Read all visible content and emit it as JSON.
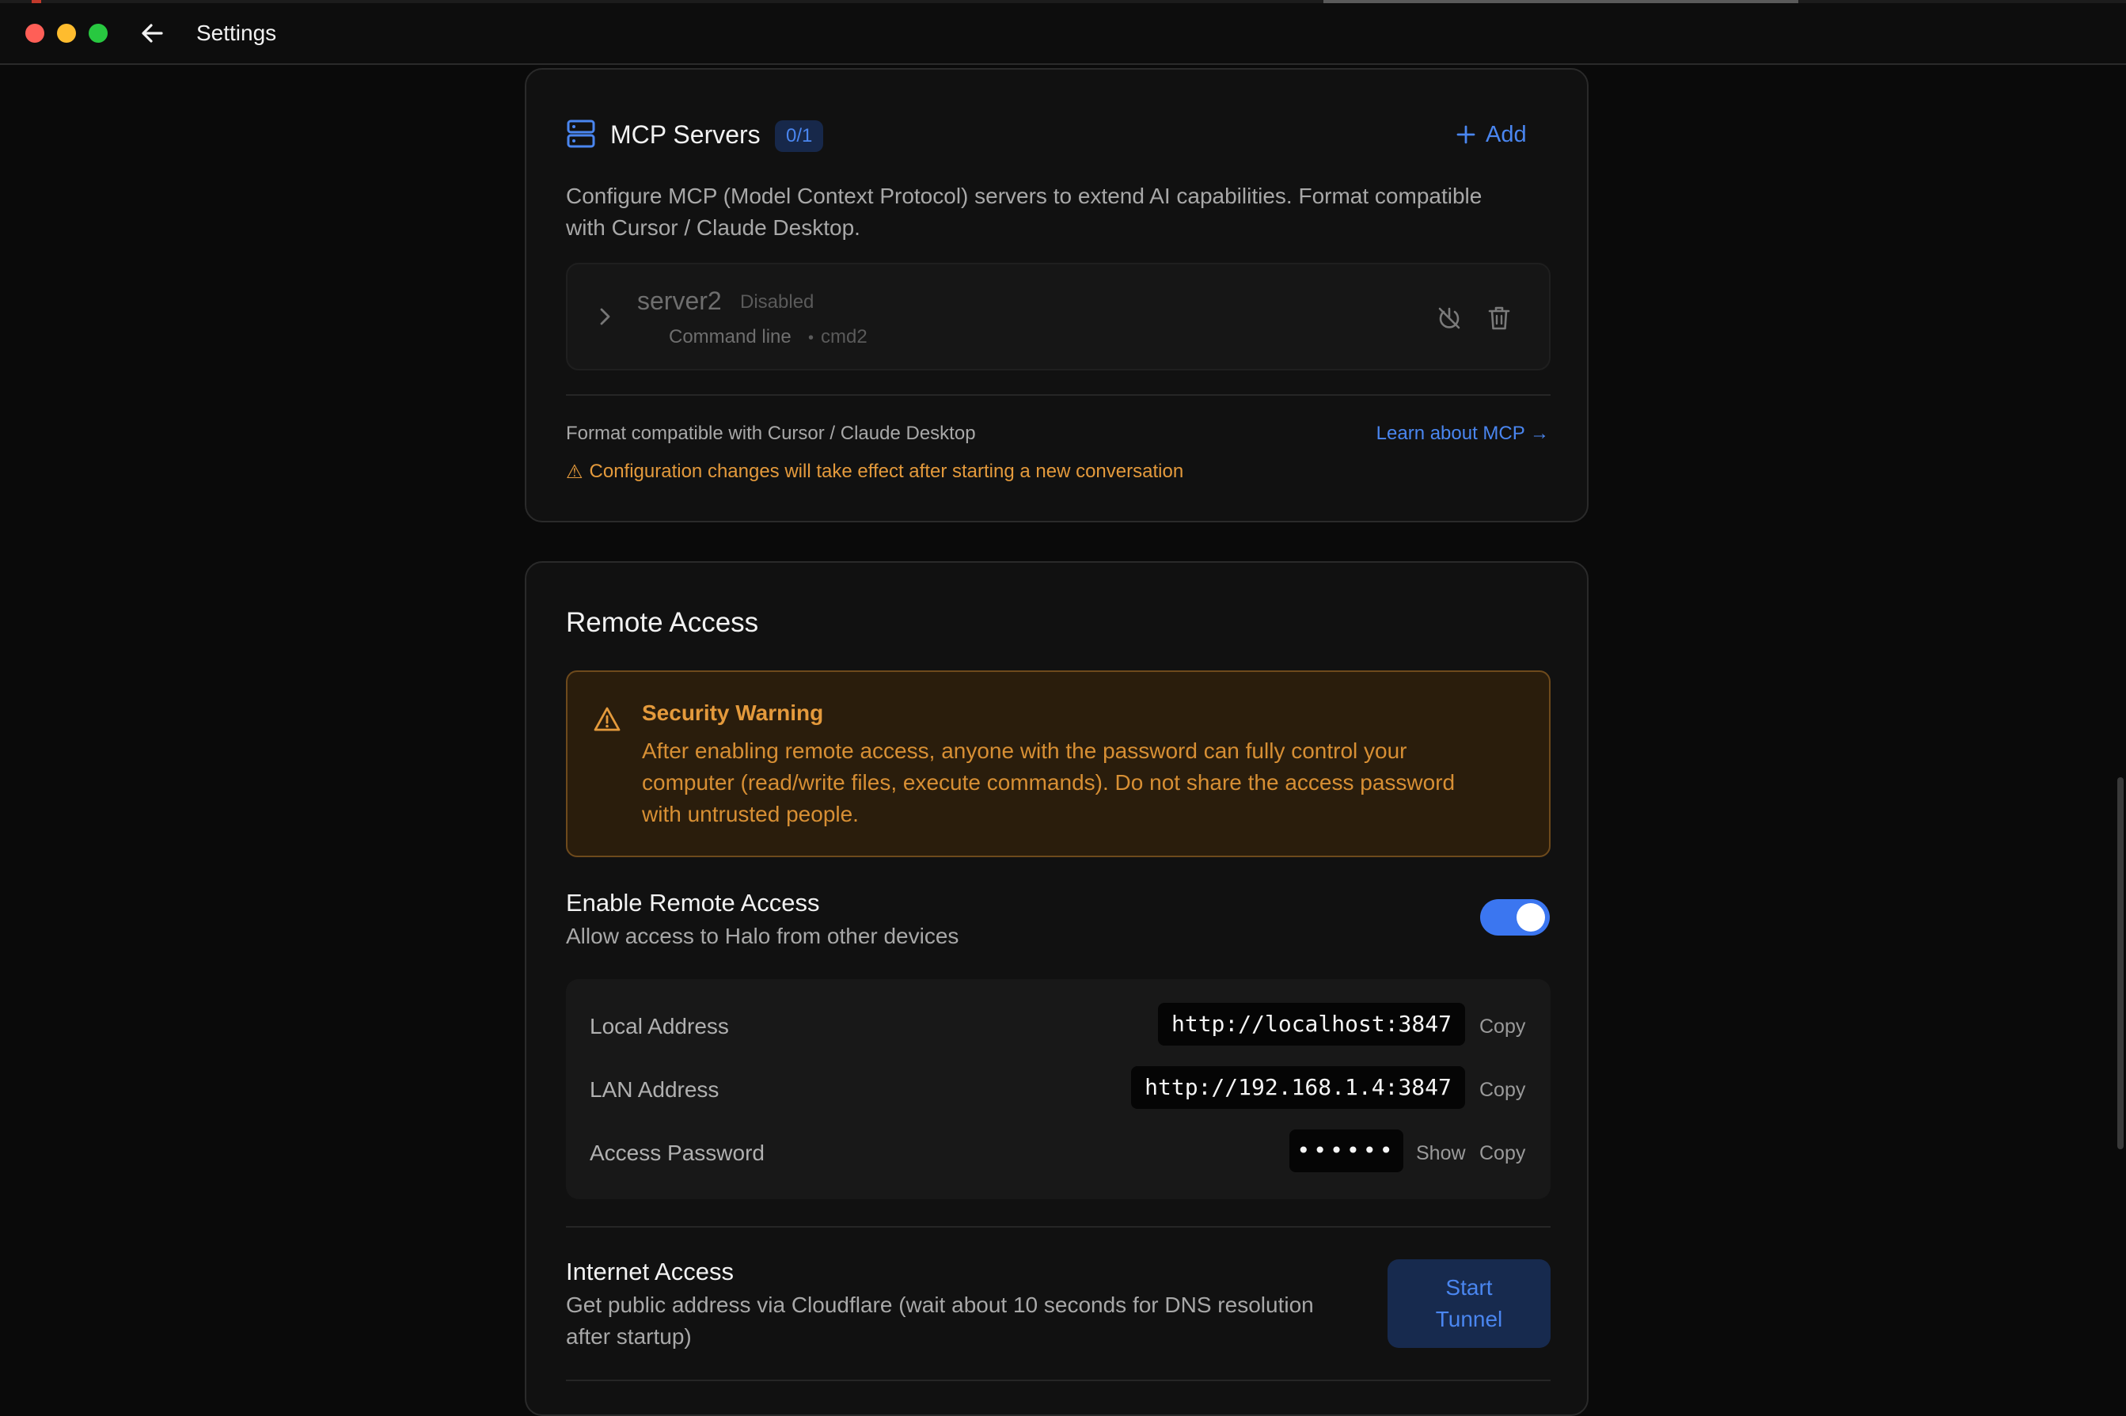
{
  "window": {
    "title": "Settings"
  },
  "colors": {
    "accent": "#4a86f0",
    "warning": "#e49a3c",
    "close": "#ff5f57",
    "minimize": "#febc2e",
    "maximize": "#28c840"
  },
  "mcp": {
    "title": "MCP Servers",
    "count_badge": "0/1",
    "add_label": "Add",
    "description_line1": "Configure MCP (Model Context Protocol) servers to extend AI capabilities. Format compatible",
    "description_line2": "with Cursor / Claude Desktop.",
    "server": {
      "name": "server2",
      "status": "Disabled",
      "type": "Command line",
      "separator": "•",
      "command": "cmd2"
    },
    "footer_note": "Format compatible with Cursor / Claude Desktop",
    "learn_link": "Learn about MCP →",
    "warning_icon": "⚠",
    "warning_text": "Configuration changes will take effect after starting a new conversation"
  },
  "remote": {
    "title": "Remote Access",
    "security": {
      "title": "Security Warning",
      "line1": "After enabling remote access, anyone with the password can fully control your",
      "line2": "computer (read/write files, execute commands). Do not share the access password",
      "line3": "with untrusted people."
    },
    "enable": {
      "title": "Enable Remote Access",
      "subtitle": "Allow access to Halo from other devices",
      "enabled": true
    },
    "local": {
      "label": "Local Address",
      "value": "http://localhost:3847",
      "copy": "Copy"
    },
    "lan": {
      "label": "LAN Address",
      "value": "http://192.168.1.4:3847",
      "copy": "Copy"
    },
    "password": {
      "label": "Access Password",
      "value": "••••••",
      "show": "Show",
      "copy": "Copy"
    },
    "internet": {
      "title": "Internet Access",
      "line1": "Get public address via Cloudflare (wait about 10 seconds for DNS resolution",
      "line2": "after startup)",
      "button_line1": "Start",
      "button_line2": "Tunnel"
    }
  }
}
